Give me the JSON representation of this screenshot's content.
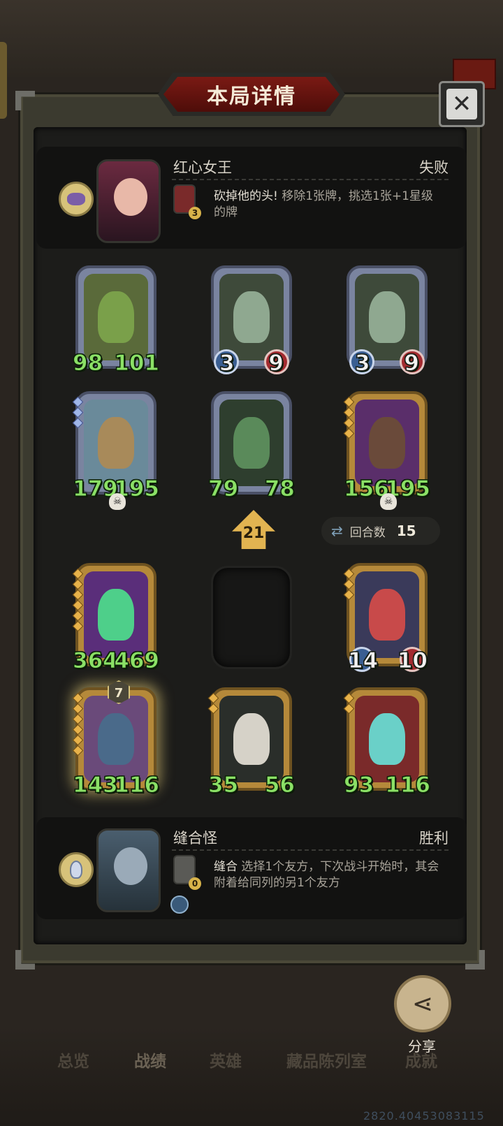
{
  "header": {
    "title": "本局详情"
  },
  "opponent": {
    "name": "红心女王",
    "result": "失败",
    "mini_badge": "3",
    "skill_name": "砍掉他的头!",
    "skill_desc": "移除1张牌，挑选1张+1星级的牌"
  },
  "player": {
    "name": "缝合怪",
    "result": "胜利",
    "mini_badge": "0",
    "skill_name": "缝合",
    "skill_desc": "选择1个友方，下次战斗开始时，其会附着给同列的另1个友方"
  },
  "opponent_board": [
    {
      "atk": "98",
      "hp": "101"
    },
    {
      "atk": "3",
      "hp": "9"
    },
    {
      "atk": "3",
      "hp": "9"
    },
    {
      "atk": "179",
      "hp": "195"
    },
    {
      "atk": "79",
      "hp": "78"
    },
    {
      "atk": "156",
      "hp": "195"
    }
  ],
  "player_board": [
    {
      "atk": "364",
      "hp": "469"
    },
    {
      "atk": "14",
      "hp": "10"
    },
    {
      "atk": "143",
      "hp": "116",
      "level": "7"
    },
    {
      "atk": "35",
      "hp": "56"
    },
    {
      "atk": "93",
      "hp": "116"
    }
  ],
  "gold_badge": "21",
  "round": {
    "label": "回合数",
    "value": "15"
  },
  "share_label": "分享",
  "nav": [
    "总览",
    "战绩",
    "英雄",
    "藏品陈列室",
    "成就"
  ],
  "build": "2820.40453083115",
  "colors": {
    "stat_green": "#8be066",
    "panel_bg": "#1c1c1a",
    "title_red": "#7a1a14"
  }
}
